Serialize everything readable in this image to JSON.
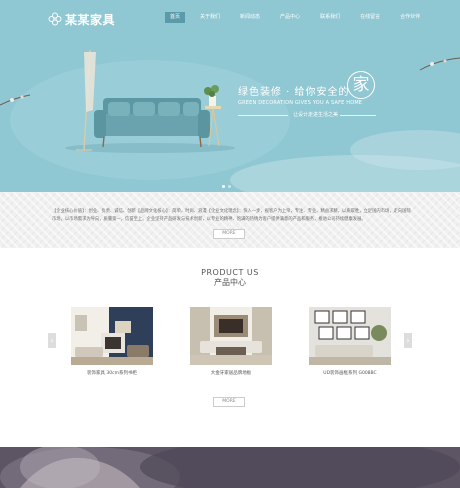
{
  "header": {
    "logo_text": "某某家具",
    "nav": [
      "首页",
      "关于我们",
      "新闻动态",
      "产品中心",
      "联系我们",
      "在线留言",
      "合作伙伴"
    ],
    "active_index": 0
  },
  "hero": {
    "slogan_cn": "绿色装修 · 给你安全的",
    "slogan_char": "家",
    "slogan_en": "GREEN DECORATION GIVES YOU A SAFE HOME",
    "slogan_sub": "让设计走进生活之美",
    "slides": 2,
    "active_slide": 0
  },
  "intro": {
    "text": "【企业核心价值】：创业、负责、诚信、创新【品牌文化核心】：简单、时尚、浪漫【企业文化理念】：快人一步，视客户为上帝，专注、专业、精益求精，以质取胜，立足国内市场，走向国际市场，以市场需求为导向，质量第一，信誉至上。企业坚持产品研发与技术创新，以专业的精神、饱满的热情为客户提供满意的产品和服务，推进公司持续健康发展。",
    "more_label": "MORE"
  },
  "products": {
    "title_en": "PRODUCT US",
    "title_cn": "产品中心",
    "prev_label": "‹",
    "next_label": "›",
    "items": [
      {
        "caption": "装饰家具 30cm系列书柜"
      },
      {
        "caption": "大金牙家居品牌地板"
      },
      {
        "caption": "UD装饰画框系列 G008BC"
      }
    ],
    "more_label": "MORE"
  },
  "colors": {
    "hero_bg": "#8fc7d2",
    "nav_active": "#5b9ba9",
    "sofa": "#6aa3ad",
    "bottom_bg": "#5d5564"
  }
}
